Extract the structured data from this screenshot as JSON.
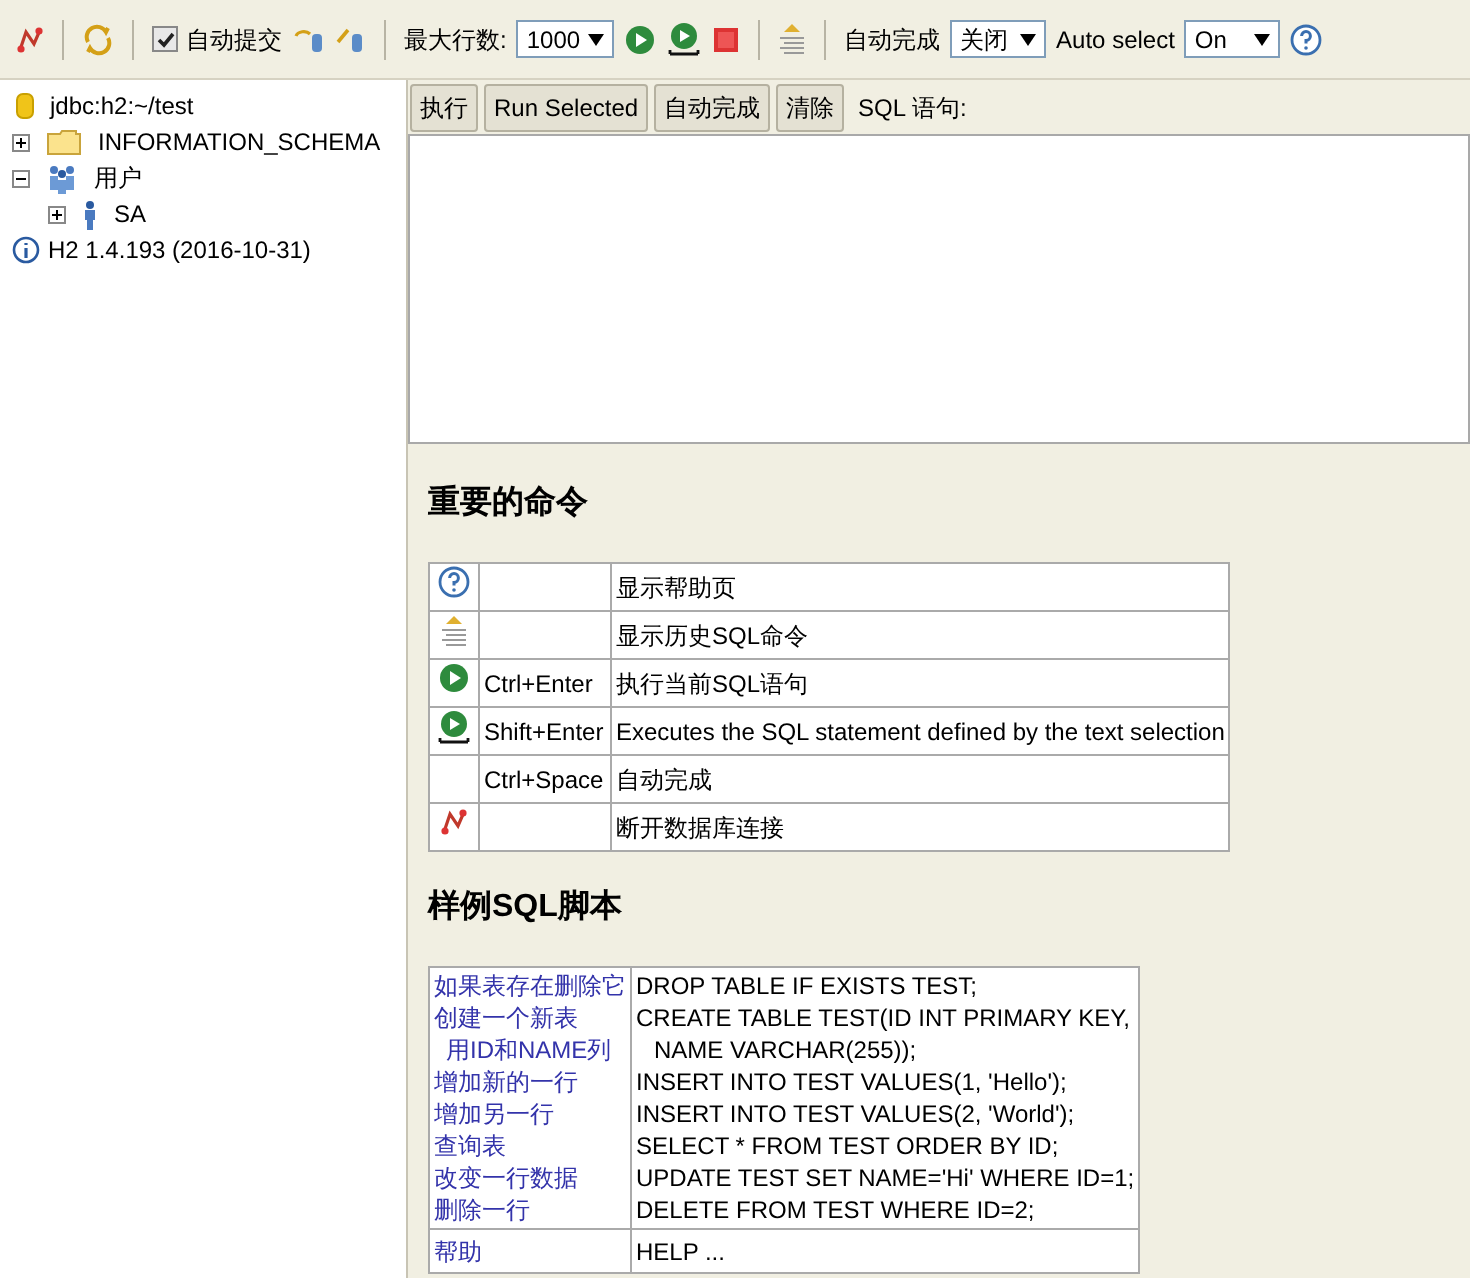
{
  "toolbar": {
    "auto_commit": {
      "label": "自动提交",
      "checked": true
    },
    "max_rows": {
      "label": "最大行数:",
      "value": "1000"
    },
    "auto_complete": {
      "label": "自动完成",
      "value": "关闭"
    },
    "auto_select": {
      "label": "Auto select",
      "value": "On"
    }
  },
  "tree": {
    "connection": "jdbc:h2:~/test",
    "items": [
      {
        "label": "INFORMATION_SCHEMA",
        "kind": "folder",
        "expanded": false
      },
      {
        "label": "用户",
        "kind": "users",
        "expanded": true,
        "children": [
          {
            "label": "SA",
            "kind": "user",
            "expanded": false
          }
        ]
      }
    ],
    "version": "H2 1.4.193 (2016-10-31)"
  },
  "query_buttons": [
    "执行",
    "Run Selected",
    "自动完成",
    "清除"
  ],
  "sql_label": "SQL 语句:",
  "commands": {
    "title": "重要的命令",
    "rows": [
      {
        "kind": "help",
        "key": "",
        "text": "显示帮助页"
      },
      {
        "kind": "history",
        "key": "",
        "text": "显示历史SQL命令"
      },
      {
        "kind": "run",
        "key": "Ctrl+Enter",
        "text": "执行当前SQL语句"
      },
      {
        "kind": "run-selected",
        "key": "Shift+Enter",
        "text": "Executes the SQL statement defined by the text selection"
      },
      {
        "kind": "none",
        "key": "Ctrl+Space",
        "text": "自动完成"
      },
      {
        "kind": "disconnect",
        "key": "",
        "text": "断开数据库连接"
      }
    ]
  },
  "samples": {
    "title": "样例SQL脚本",
    "lines": [
      {
        "link": "如果表存在删除它",
        "sql": "DROP TABLE IF EXISTS TEST;",
        "indent": false
      },
      {
        "link": "创建一个新表",
        "sql": "CREATE TABLE TEST(ID INT PRIMARY KEY,",
        "indent": false
      },
      {
        "link": "用ID和NAME列",
        "sql": "NAME VARCHAR(255));",
        "indent": true
      },
      {
        "link": "增加新的一行",
        "sql": "INSERT INTO TEST VALUES(1, 'Hello');",
        "indent": false
      },
      {
        "link": "增加另一行",
        "sql": "INSERT INTO TEST VALUES(2, 'World');",
        "indent": false
      },
      {
        "link": "查询表",
        "sql": "SELECT * FROM TEST ORDER BY ID;",
        "indent": false
      },
      {
        "link": "改变一行数据",
        "sql": "UPDATE TEST SET NAME='Hi' WHERE ID=1;",
        "indent": false
      },
      {
        "link": "删除一行",
        "sql": "DELETE FROM TEST WHERE ID=2;",
        "indent": false
      }
    ],
    "help": {
      "link": "帮助",
      "sql": "HELP ..."
    }
  }
}
